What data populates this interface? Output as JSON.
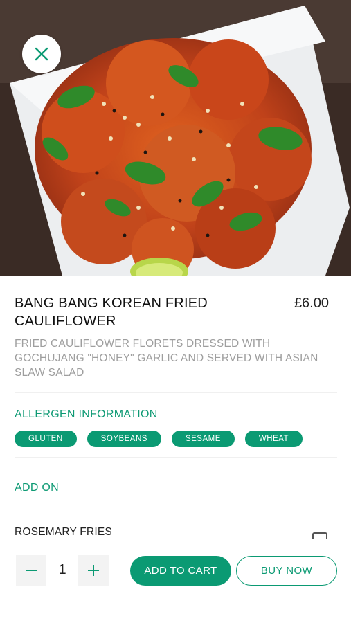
{
  "product": {
    "title": "BANG BANG KOREAN FRIED CAULIFLOWER",
    "price": "£6.00",
    "description": "FRIED CAULIFLOWER FLORETS DRESSED WITH GOCHUJANG \"HONEY\" GARLIC AND SERVED WITH ASIAN SLAW SALAD"
  },
  "allergens": {
    "heading": "ALLERGEN INFORMATION",
    "items": [
      "GLUTEN",
      "SOYBEANS",
      "SESAME",
      "WHEAT"
    ]
  },
  "addons": {
    "heading": "ADD ON",
    "items": [
      {
        "name": "ROSEMARY FRIES"
      }
    ]
  },
  "cart": {
    "quantity": "1",
    "add_to_cart_label": "ADD TO CART",
    "buy_now_label": "BUY NOW"
  },
  "icons": {
    "close": "close-icon",
    "minus": "minus-icon",
    "plus": "plus-icon"
  },
  "colors": {
    "accent": "#0b9a73"
  }
}
